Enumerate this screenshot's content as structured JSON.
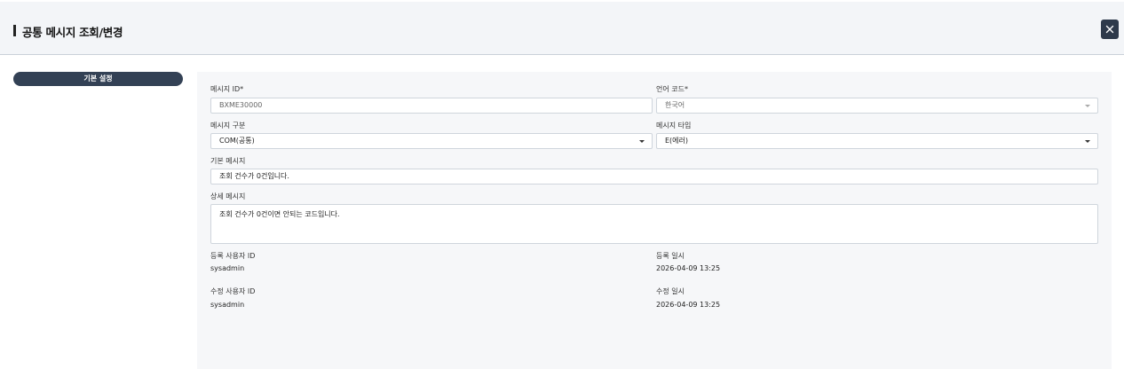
{
  "header": {
    "title": "공통 메시지 조회/변경"
  },
  "sidebar": {
    "tab_label": "기본 설정"
  },
  "form": {
    "message_id": {
      "label": "메시지 ID*",
      "value": "BXME30000"
    },
    "language_code": {
      "label": "언어 코드*",
      "value": "한국어"
    },
    "message_category": {
      "label": "메시지 구분",
      "value": "COM(공통)"
    },
    "message_type": {
      "label": "메시지 타입",
      "value": "E(에러)"
    },
    "basic_message": {
      "label": "기본 메시지",
      "value": "조회 건수가 0건입니다."
    },
    "detail_message": {
      "label": "상세 메시지",
      "value": "조회 건수가 0건이면 안되는 코드입니다."
    },
    "registered_user": {
      "label": "등록 사용자 ID",
      "value": "sysadmin"
    },
    "registered_at": {
      "label": "등록 일시",
      "value": "2026-04-09 13:25"
    },
    "modified_user": {
      "label": "수정 사용자 ID",
      "value": "sysadmin"
    },
    "modified_at": {
      "label": "수정 일시",
      "value": "2026-04-09 13:25"
    }
  }
}
